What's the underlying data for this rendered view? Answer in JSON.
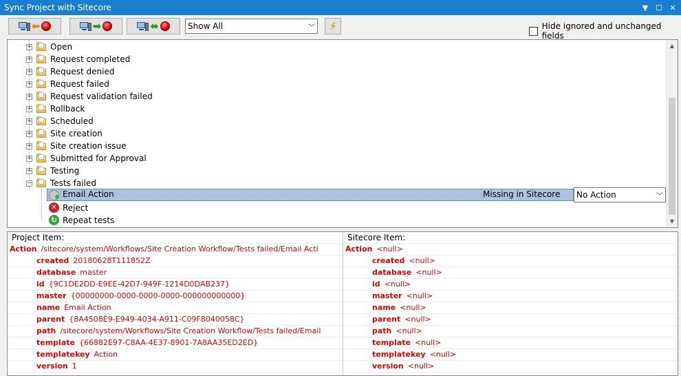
{
  "window": {
    "title": "Sync Project with Sitecore",
    "controls": [
      "chevron-down-icon",
      "maximize-icon",
      "close-icon"
    ]
  },
  "toolbar": {
    "filter": {
      "value": "Show All"
    },
    "hide_ignored_label": "Hide ignored and unchanged fields",
    "hide_ignored_checked": false
  },
  "tree": {
    "folders": [
      {
        "label": "Open",
        "expander": "+"
      },
      {
        "label": "Request completed",
        "expander": "+"
      },
      {
        "label": "Request denied",
        "expander": "+"
      },
      {
        "label": "Request failed",
        "expander": "+"
      },
      {
        "label": "Request validation failed",
        "expander": "+"
      },
      {
        "label": "Rollback",
        "expander": "+"
      },
      {
        "label": "Scheduled",
        "expander": "+"
      },
      {
        "label": "Site creation",
        "expander": "+"
      },
      {
        "label": "Site creation issue",
        "expander": "+"
      },
      {
        "label": "Submitted for Approval",
        "expander": "+"
      },
      {
        "label": "Testing",
        "expander": "+"
      },
      {
        "label": "Tests failed",
        "expander": "−"
      }
    ],
    "children": [
      {
        "label": "Email Action",
        "status": "Missing in Sitecore",
        "action": "No Action"
      },
      {
        "label": "Reject"
      },
      {
        "label": "Repeat tests"
      }
    ]
  },
  "project_pane": {
    "header": "Project Item:",
    "rows": [
      {
        "key": "Action",
        "value": "/sitecore/system/Workflows/Site Creation Workflow/Tests failed/Email Acti"
      },
      {
        "key": "created",
        "value": "20180628T111852Z"
      },
      {
        "key": "database",
        "value": "master"
      },
      {
        "key": "id",
        "value": "{9C1DE2DD-E9EE-42D7-949F-1214D0DAB237}"
      },
      {
        "key": "master",
        "value": "{00000000-0000-0000-0000-000000000000}"
      },
      {
        "key": "name",
        "value": "Email Action"
      },
      {
        "key": "parent",
        "value": "{8A4508E9-E949-4034-A911-C09F8040058C}"
      },
      {
        "key": "path",
        "value": "/sitecore/system/Workflows/Site Creation Workflow/Tests failed/Email"
      },
      {
        "key": "template",
        "value": "{66882E97-C8AA-4E37-8901-7A8AA35ED2ED}"
      },
      {
        "key": "templatekey",
        "value": "Action"
      },
      {
        "key": "version",
        "value": "1"
      }
    ]
  },
  "sitecore_pane": {
    "header": "Sitecore Item:",
    "rows": [
      {
        "key": "Action",
        "value": "<null>"
      },
      {
        "key": "created",
        "value": "<null>"
      },
      {
        "key": "database",
        "value": "<null>"
      },
      {
        "key": "id",
        "value": "<null>"
      },
      {
        "key": "master",
        "value": "<null>"
      },
      {
        "key": "name",
        "value": "<null>"
      },
      {
        "key": "parent",
        "value": "<null>"
      },
      {
        "key": "path",
        "value": "<null>"
      },
      {
        "key": "template",
        "value": "<null>"
      },
      {
        "key": "templatekey",
        "value": "<null>"
      },
      {
        "key": "version",
        "value": "<null>"
      }
    ]
  }
}
